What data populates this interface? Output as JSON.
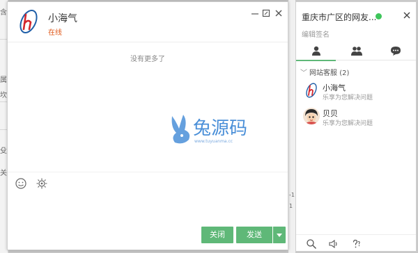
{
  "background": {
    "left_fragments": [
      "含",
      "属",
      "坎",
      "殳",
      "关"
    ],
    "right_fragments": [
      "-1",
      "1"
    ]
  },
  "chat": {
    "contact_name": "小海气",
    "status": "在线",
    "no_more_text": "没有更多了",
    "watermark_text": "兔源码",
    "watermark_sub": "www.tuyuanma.cc",
    "close_button": "关闭",
    "send_button": "发送",
    "window_icons": [
      "minimize-icon",
      "maximize-icon",
      "close-icon"
    ],
    "toolbar_icons": [
      "emoji-icon",
      "image-icon"
    ]
  },
  "panel": {
    "title": "重庆市广区的网友...",
    "signature_placeholder": "编辑签名",
    "tabs": [
      "friend-icon",
      "group-icon",
      "history-icon"
    ],
    "group_label": "网站客服",
    "group_count": "(2)",
    "friends": [
      {
        "name": "小海气",
        "sign": "乐享为您解决问题",
        "avatar": "logo"
      },
      {
        "name": "贝贝",
        "sign": "乐享为您解决问题",
        "avatar": "person"
      }
    ],
    "bottom_icons": [
      "search-icon",
      "sound-icon",
      "help-icon"
    ],
    "online_color": "#3ec55b"
  },
  "colors": {
    "accent": "#5fb878",
    "status": "#e05a1b"
  }
}
